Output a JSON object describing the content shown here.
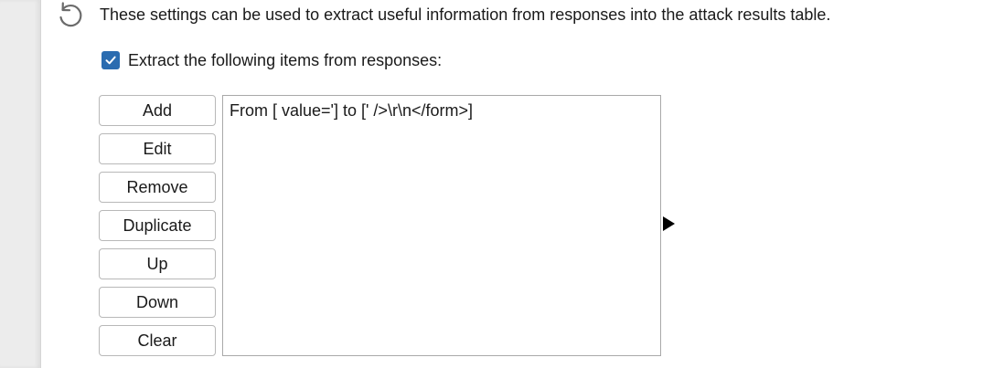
{
  "description": "These settings can be used to extract useful information from responses into the attack results table.",
  "revert_icon": "revert-icon",
  "checkbox": {
    "label": "Extract the following items from responses:",
    "checked": true,
    "color": "#2b6cb0"
  },
  "buttons": {
    "add": "Add",
    "edit": "Edit",
    "remove": "Remove",
    "duplicate": "Duplicate",
    "up": "Up",
    "down": "Down",
    "clear": "Clear"
  },
  "list": {
    "items": [
      "From [ value='] to [' />\\r\\n</form>]"
    ]
  },
  "expand_icon": "triangle-right-icon"
}
